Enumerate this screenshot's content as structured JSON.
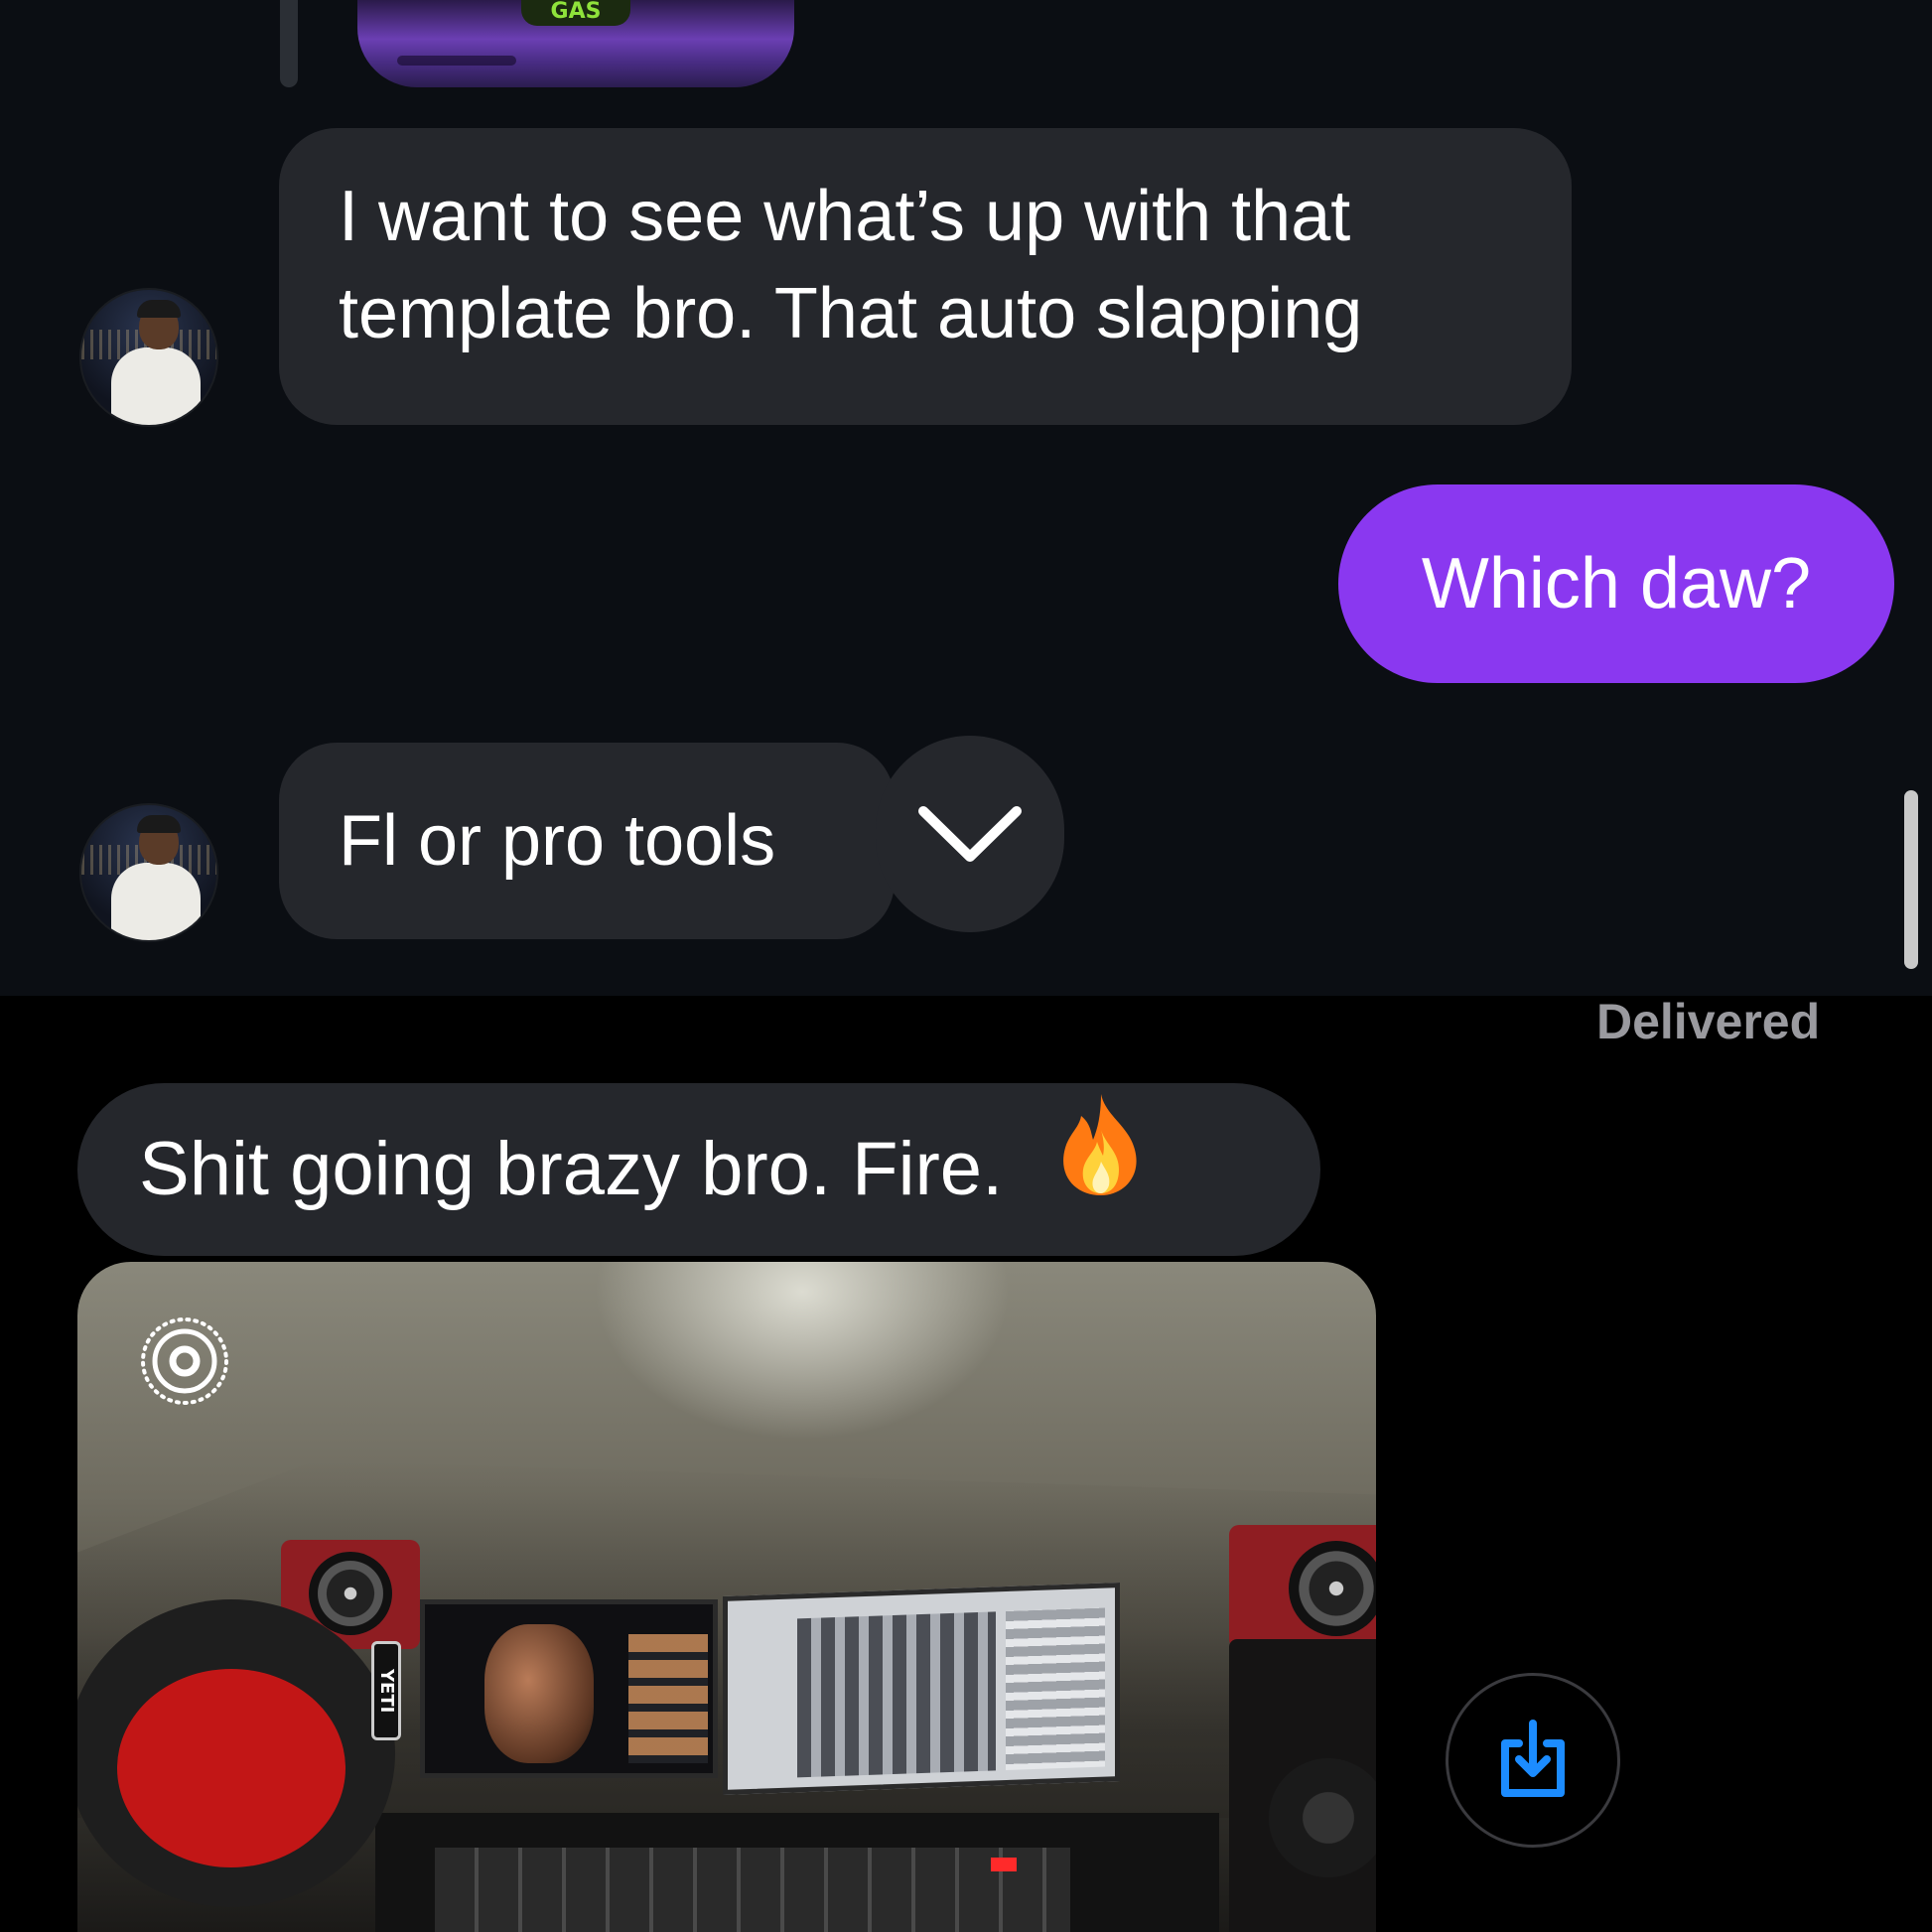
{
  "thread": {
    "shared_media": {
      "sticker_text": "GAS"
    },
    "messages": [
      {
        "id": "m1",
        "direction": "incoming",
        "lines": [
          "I want to see what’s up with that",
          "template bro. That auto slapping"
        ]
      },
      {
        "id": "m2",
        "direction": "outgoing",
        "text": "Which daw?"
      },
      {
        "id": "m3",
        "direction": "incoming",
        "text": "Fl or pro tools"
      },
      {
        "id": "m4",
        "direction": "incoming",
        "text": "Shit going brazy bro. Fire.",
        "emoji": "fire"
      }
    ],
    "status": "Delivered",
    "photo": {
      "monitor_label": "YETI",
      "live_photo": true
    }
  },
  "icons": {
    "expand": "chevron-down-icon",
    "live": "live-photo-icon",
    "save": "download-icon"
  },
  "colors": {
    "background_top": "#0b0e13",
    "background_bottom": "#000000",
    "incoming_bubble": "#25272c",
    "outgoing_bubble": "#8a38f0",
    "save_icon": "#1c8cff",
    "status_text": "#9a9a9f"
  }
}
